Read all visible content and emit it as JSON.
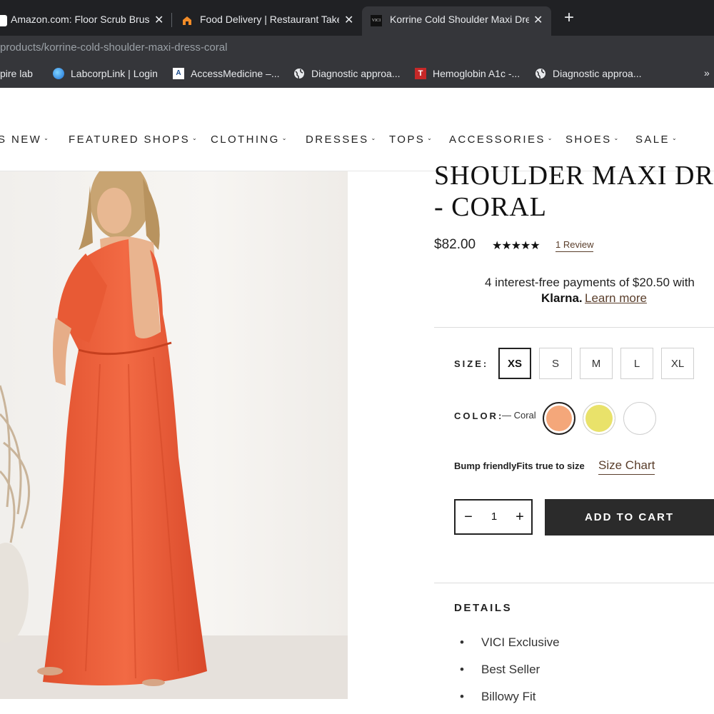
{
  "browser": {
    "tabs": [
      {
        "title": "Amazon.com: Floor Scrub Brus",
        "icon": "amazon-icon",
        "active": false
      },
      {
        "title": "Food Delivery | Restaurant Take",
        "icon": "grubhub-icon",
        "active": false
      },
      {
        "title": "Korrine Cold Shoulder Maxi Dre",
        "icon": "vici-icon",
        "active": true
      }
    ],
    "new_tab": "+",
    "close_glyph": "✕",
    "url": "products/korrine-cold-shoulder-maxi-dress-coral",
    "bookmarks": [
      {
        "label": "pire lab",
        "icon": "page-icon"
      },
      {
        "label": "LabcorpLink | Login",
        "icon": "labcorp-icon"
      },
      {
        "label": "AccessMedicine –...",
        "icon": "access-medicine-icon"
      },
      {
        "label": "Diagnostic approa...",
        "icon": "globe-icon"
      },
      {
        "label": "Hemoglobin A1c -...",
        "icon": "t-icon"
      },
      {
        "label": "Diagnostic approa...",
        "icon": "globe-icon"
      }
    ],
    "bookmarks_more": "»"
  },
  "nav": {
    "items": [
      "S NEW",
      "FEATURED SHOPS",
      "CLOTHING",
      "DRESSES",
      "TOPS",
      "ACCESSORIES",
      "SHOES",
      "SALE"
    ],
    "chevron": "⌄"
  },
  "product": {
    "title_line1": "SHOULDER MAXI DRE",
    "title_line2": "- CORAL",
    "price": "$82.00",
    "stars": "★★★★★",
    "rating": 5,
    "reviews_link": "1 Review",
    "klarna_text": "4 interest-free payments of $20.50 with",
    "klarna_brand": "Klarna.",
    "klarna_link": "Learn more",
    "size_label": "SIZE:",
    "sizes": [
      "XS",
      "S",
      "M",
      "L",
      "XL"
    ],
    "selected_size": "XS",
    "color_label": "COLOR:",
    "color_name": "— Coral",
    "swatches": [
      {
        "name": "coral",
        "color": "#f4a77a",
        "selected": true
      },
      {
        "name": "yellow",
        "color": "#e9e26a",
        "selected": false
      },
      {
        "name": "white",
        "color": "#ffffff",
        "selected": false
      }
    ],
    "fit_text": "Bump friendlyFits true to size",
    "size_chart": "Size Chart",
    "quantity": "1",
    "qty_minus": "−",
    "qty_plus": "+",
    "add_to_cart": "ADD TO CART",
    "details_title": "DETAILS",
    "details": [
      "VICI Exclusive",
      "Best Seller",
      "Billowy Fit"
    ],
    "bullet": "•"
  },
  "colors": {
    "dress": "#f0643f",
    "link_brown": "#5a3e2b",
    "cart_button": "#2b2b2b"
  }
}
